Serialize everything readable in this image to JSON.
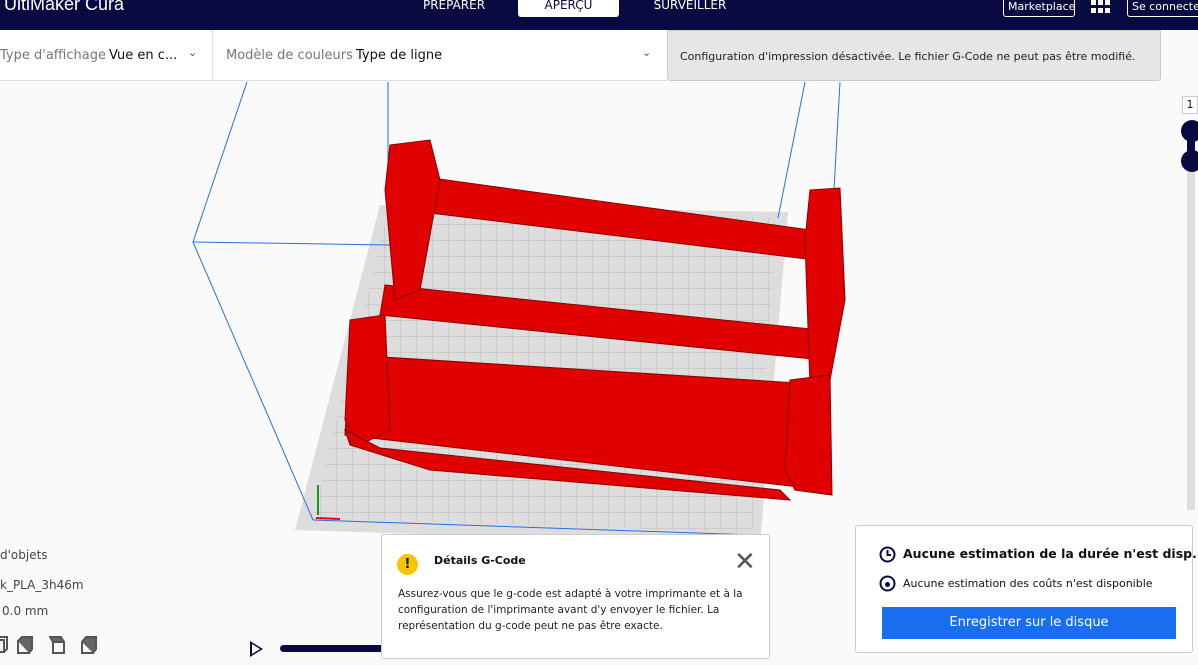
{
  "header": {
    "app_title": "UltiMaker Cura",
    "tabs": [
      {
        "label": "PRÉPARER"
      },
      {
        "label": "APERÇU",
        "active": true
      },
      {
        "label": "SURVEILLER"
      }
    ],
    "marketplace": "Marketplace",
    "apps_icon": "grid-icon",
    "sign_in": "Se connecter"
  },
  "toolbar": {
    "view_type_label": "Type d'affichage",
    "view_type_value": "Vue en c...",
    "color_scheme_label": "Modèle de couleurs",
    "color_scheme_value": "Type de ligne",
    "notice": "Configuration d'impression désactivée. Le fichier G-Code ne peut pas être modifié."
  },
  "object_panel": {
    "title": "d'objets",
    "file": "k_PLA_3h46m",
    "dims": "0.0 mm"
  },
  "layer_slider": {
    "value": "1"
  },
  "gcode_card": {
    "title": "Détails G-Code",
    "body": "Assurez-vous que le g-code est adapté à votre imprimante et à la configuration de l'imprimante avant d'y envoyer le fichier. La représentation du g-code peut ne pas être exacte."
  },
  "estimate_card": {
    "time": "Aucune estimation de la durée n'est disp...",
    "cost": "Aucune estimation des coûts n'est disponible",
    "save_button": "Enregistrer sur le disque"
  },
  "colors": {
    "header": "#0a0a42",
    "accent": "#196ef0",
    "model": "#e00000",
    "warning": "#f7c600"
  }
}
